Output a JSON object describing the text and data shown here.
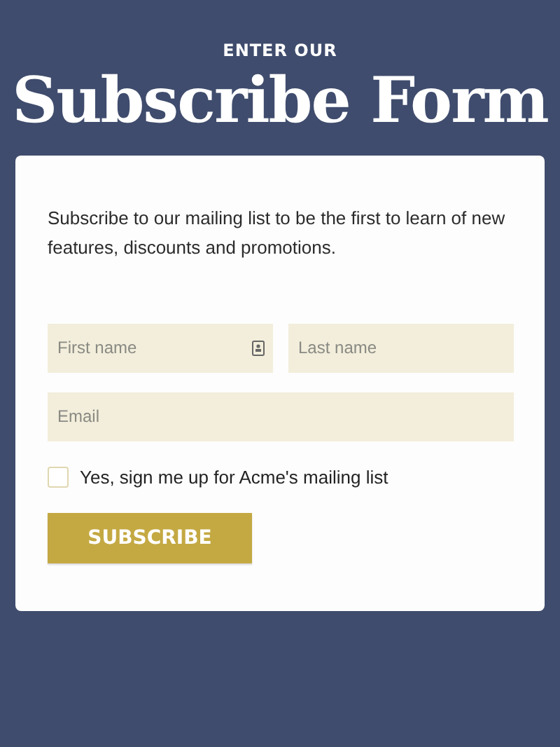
{
  "header": {
    "kicker": "ENTER OUR",
    "title": "Subscribe Form"
  },
  "intro": "Subscribe to our mailing list to be the first to learn of new features, discounts and promotions.",
  "fields": [
    {
      "placeholder": "First name",
      "contact_icon": true
    },
    {
      "placeholder": "Last name",
      "contact_icon": false
    },
    {
      "placeholder": "Email",
      "contact_icon": false
    }
  ],
  "consent": {
    "label": "Yes, sign me up for Acme's mailing list",
    "checked": false
  },
  "submit_button": "SUBSCRIBE"
}
